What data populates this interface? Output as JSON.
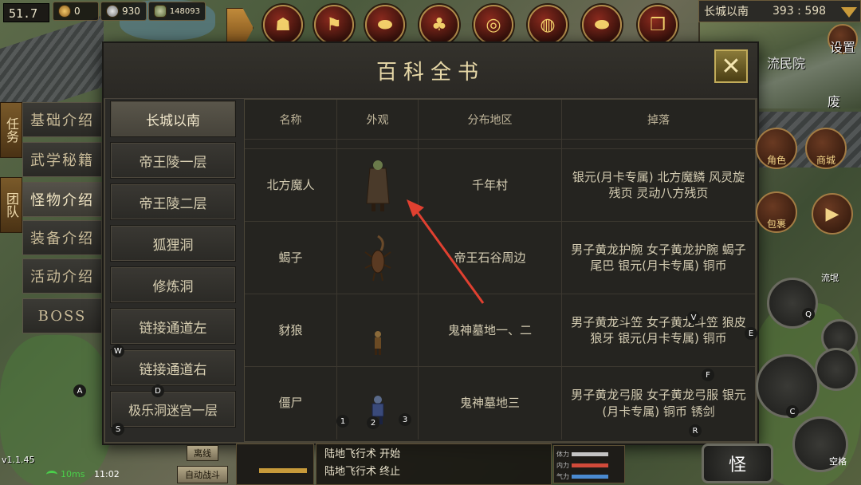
{
  "hud": {
    "fps": "51.7",
    "gold": "0",
    "silver": "930",
    "other_currency": "148093",
    "location": "长城以南",
    "coords": "393 : 598",
    "minimap_places": [
      "流民院",
      "废"
    ],
    "settings_label": "设置",
    "version": "v1.1.45",
    "ping": "10ms",
    "clock": "11:02",
    "side_quest": "任务",
    "side_team": "团队",
    "player_label": "流氓"
  },
  "top_icons": [
    "pumpkin-helmet-icon",
    "red-banner-icon",
    "gold-ingot-icon",
    "money-tree-icon",
    "shield-icon",
    "drum-icon",
    "gold-ingot-stack-icon",
    "gift-box-icon"
  ],
  "categories": [
    "基础介绍",
    "武学秘籍",
    "怪物介绍",
    "装备介绍",
    "活动介绍",
    "BOSS"
  ],
  "active_category": 2,
  "dialog": {
    "title": "百科全书",
    "close_label": "✕",
    "maps": [
      "长城以南",
      "帝王陵一层",
      "帝王陵二层",
      "狐狸洞",
      "修炼洞",
      "链接通道左",
      "链接通道右",
      "极乐洞迷宫一层"
    ],
    "active_map": 0,
    "headers": {
      "name": "名称",
      "look": "外观",
      "area": "分布地区",
      "drop": "掉落"
    },
    "rows": [
      {
        "name": "北方魔人",
        "area": "千年村",
        "drop": "银元(月卡专属) 北方魔鳞 风灵旋残页 灵动八方残页",
        "sprite": "demon"
      },
      {
        "name": "蝎子",
        "area": "帝王石谷周边",
        "drop": "男子黄龙护腕 女子黄龙护腕 蝎子尾巴 银元(月卡专属) 铜币",
        "sprite": "scorpion"
      },
      {
        "name": "豺狼",
        "area": "鬼神墓地一、二",
        "drop": "男子黄龙斗笠 女子黄龙斗笠 狼皮 狼牙 银元(月卡专属) 铜币",
        "sprite": "wolf"
      },
      {
        "name": "僵尸",
        "area": "鬼神墓地三",
        "drop": "男子黄龙弓服 女子黄龙弓服 银元(月卡专属) 铜币 锈剑",
        "sprite": "zombie"
      }
    ]
  },
  "right_buttons": {
    "role": "角色",
    "shop": "商城",
    "bag": "包裹"
  },
  "key_hints": [
    "W",
    "A",
    "D",
    "S",
    "1",
    "2",
    "3",
    "V",
    "E",
    "F",
    "R",
    "Q",
    "C"
  ],
  "bottom": {
    "log": [
      "陆地飞行术 开始",
      "陆地飞行术 终止"
    ],
    "auto_battle": "自动战斗",
    "leave_label": "离线",
    "jump_label": "空格",
    "monster_button": "怪",
    "bars": [
      "体力",
      "内力",
      "气力"
    ]
  },
  "colors": {
    "panel": "#2b2a27",
    "title": "#e8d9a8",
    "accent": "#c2ac5a",
    "pointer": "#e04030"
  }
}
